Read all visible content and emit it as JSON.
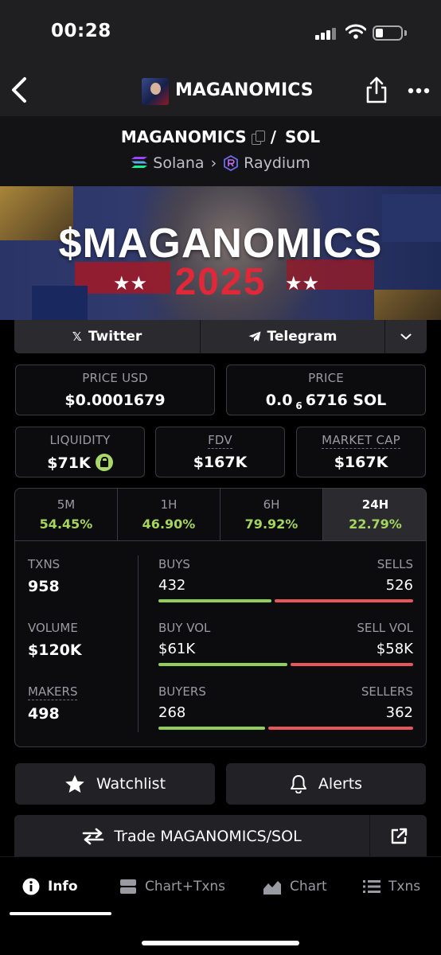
{
  "status_bar": {
    "time": "00:28"
  },
  "header": {
    "title": "MAGANOMICS",
    "icons": [
      "back-icon",
      "token-avatar",
      "share-icon",
      "more-icon"
    ]
  },
  "pair": {
    "base": "MAGANOMICS",
    "separator": "/",
    "quote": "SOL",
    "chain": "Solana",
    "dex": "Raydium"
  },
  "banner": {
    "title": "$MAGANOMICS",
    "year": "2025"
  },
  "social": {
    "twitter": "Twitter",
    "telegram": "Telegram"
  },
  "stats": {
    "price_usd": {
      "label": "PRICE USD",
      "value": "$0.0001679"
    },
    "price_native": {
      "label": "PRICE",
      "prefix": "0.0",
      "subscript": "6",
      "suffix": "6716 SOL"
    },
    "liquidity": {
      "label": "LIQUIDITY",
      "value": "$71K"
    },
    "fdv": {
      "label": "FDV",
      "value": "$167K"
    },
    "market_cap": {
      "label": "MARKET CAP",
      "value": "$167K"
    }
  },
  "timeframes": [
    {
      "label": "5M",
      "change": "54.45%"
    },
    {
      "label": "1H",
      "change": "46.90%"
    },
    {
      "label": "6H",
      "change": "79.92%"
    },
    {
      "label": "24H",
      "change": "22.79%",
      "active": true
    }
  ],
  "activity": {
    "txns": {
      "label": "TXNS",
      "value": "958"
    },
    "volume": {
      "label": "VOLUME",
      "value": "$120K"
    },
    "makers": {
      "label": "MAKERS",
      "value": "498"
    },
    "buys": {
      "label": "BUYS",
      "value": "432"
    },
    "sells": {
      "label": "SELLS",
      "value": "526"
    },
    "buy_vol": {
      "label": "BUY VOL",
      "value": "$61K"
    },
    "sell_vol": {
      "label": "SELL VOL",
      "value": "$58K"
    },
    "buyers": {
      "label": "BUYERS",
      "value": "268"
    },
    "sellers": {
      "label": "SELLERS",
      "value": "362"
    },
    "ratios": {
      "txns_buy_share": 0.451,
      "volume_buy_share": 0.513,
      "makers_buy_share": 0.425
    }
  },
  "actions": {
    "watchlist": "Watchlist",
    "alerts": "Alerts",
    "trade": "Trade MAGANOMICS/SOL"
  },
  "tabs": [
    {
      "label": "Info",
      "icon": "info-icon",
      "active": true
    },
    {
      "label": "Chart+Txns",
      "icon": "chart-txns-icon"
    },
    {
      "label": "Chart",
      "icon": "chart-icon"
    },
    {
      "label": "Txns",
      "icon": "list-icon"
    }
  ],
  "colors": {
    "positive": "#a4d65e",
    "buy_bar": "#8fcf5a",
    "sell_bar": "#e4575a",
    "banner_year": "#e02838"
  }
}
